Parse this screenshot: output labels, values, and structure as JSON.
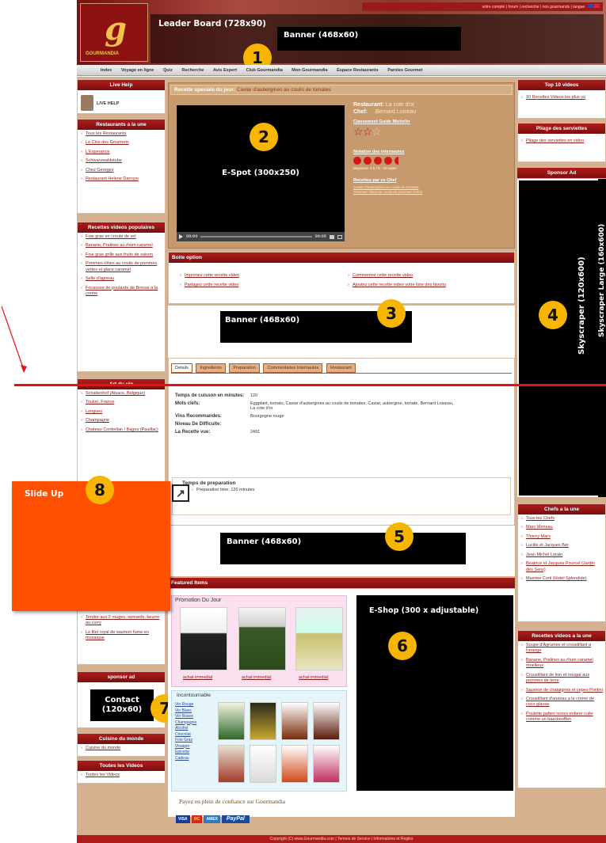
{
  "colors": {
    "accent": "#b01c1c",
    "sidebar_bg": "#d5b18f",
    "ad_black": "#000000",
    "slide_orange": "#ff4f00",
    "badge": "#f7b500",
    "tan": "#c69a6d"
  },
  "header": {
    "logo_text": "GOURMANDIA",
    "top_links": [
      "votre compte",
      "forum",
      "recherche",
      "nos gourmands",
      "langue"
    ],
    "leaderboard_label": "Leader Board (728x90)",
    "banner_label": "Banner (468x60)",
    "badge": "1"
  },
  "nav": [
    "Index",
    "Voyage en ligne",
    "Quiz",
    "Recherche",
    "Avis Expert",
    "Club Gourmandia",
    "Mon Gourmandia",
    "Espace Restaurants",
    "Paroles Gourmet"
  ],
  "left": {
    "live_help_title": "Live Help",
    "live_help_label": "LIVE HELP",
    "restaurants_title": "Restaurants a la une",
    "restaurants": [
      "Tous les Restaurants",
      "Le Clos des Gourmets",
      "L'Esperance",
      "Schwarzwaldstube",
      "Chez Georges",
      "Restaurant Helene Darroze"
    ],
    "videos_title": "Recettes videos populaires",
    "videos": [
      "Foie gras en croute de sel",
      "Banane, Pralines au rhum caramel",
      "Foie gras grille aux fruits de saison",
      "Pommes rôties au coulis de pommes vertes et glace caramel",
      "Selle d'agneau",
      "Fricassee de poularde de Bresse a la creme"
    ],
    "art_title": "Art du vin",
    "art": [
      "Schaltenhof (Alsace, Belgique)",
      "Toulon, France",
      "Longues",
      "Champagne",
      "Chateau Cordeillan / Bages (Pauillac)"
    ],
    "lower_links": [
      "Tendre aux 2 rouges, epinards, beurre au curry",
      "Le filet royal de saumon fume en mosaique"
    ],
    "sponsor_title": "sponsor ad",
    "contact_label": "Contact (120x60)",
    "cuisine_title": "Cuisine du monde",
    "cuisine_link": "Cuisine du monde",
    "toutes_title": "Toutes les Videos",
    "toutes_link": "Toutes les Videos",
    "badge": "7"
  },
  "slide_up": {
    "label": "Slide Up",
    "badge": "8"
  },
  "recipe": {
    "title_prefix": "Recette speciale du jour:",
    "title": "Caviar d'aubergines au coulis de tomates",
    "restaurant_label": "Restaurant:",
    "restaurant_value": "La cote d'or",
    "chef_label": "Chef:",
    "chef_value": "Bernard Loiseau",
    "guide_label": "Classement Guide Michelin",
    "stars_label": "Notation des internautes",
    "votes": "Moyenne: 4.5 / 5 - 10 votes",
    "more_label": "Recettes par ce Chef",
    "more_links": [
      "Caviar d'aubergines au coulis de tomates",
      "Pommes rôties au coulis de pommes vertes"
    ],
    "video_label": "E-Spot (300x250)",
    "video_time_left": "00:00",
    "video_time_right": "00:05",
    "badge": "2"
  },
  "options": {
    "title": "Boite option",
    "items": [
      "Imprimez cette recette video",
      "Partagez cette recette video",
      "Commentez cette recette video",
      "Ajoutez cette recette video votre liste des favoris"
    ]
  },
  "banner3": {
    "label": "Banner (468x60)",
    "badge": "3"
  },
  "tabs": [
    "Details",
    "Ingredients",
    "Preparation",
    "Commentaires Internautes",
    "Restaurant"
  ],
  "details": [
    {
      "label": "Temps de cuisson en minutes:",
      "value": "120"
    },
    {
      "label": "Mots clefs:",
      "value": "Eggplant, tomato, Caviar d'aubergines au coulis de tomates, Caviar, aubergine, tomate, Bernard Loiseau, La cote d'or"
    },
    {
      "label": "Vins Recommandes:",
      "value": "Bourgogne rouge"
    },
    {
      "label": "Niveau De Difficulte:",
      "value": ""
    },
    {
      "label": "La Recette vue:",
      "value": "2491"
    }
  ],
  "prep": {
    "title": "Temps de preparation",
    "text": "Preparation time: 120 minutes"
  },
  "banner5": {
    "label": "Banner (468x60)",
    "badge": "5"
  },
  "featured": {
    "title": "Featured Items",
    "promo_title": "Promotion Du Jour",
    "buy_labels": [
      "achat immediat",
      "achat immediat",
      "achat immediat"
    ],
    "incont_title": "Incontournable",
    "incont_links": [
      "Vin Rouge",
      "Vin Blanc",
      "Vin Rosee",
      "Champagne",
      "Alcohol",
      "Chocolat",
      "Foie Gras",
      "Vinaigre",
      "Epicerie",
      "Cadeau"
    ],
    "pay_text": "Payez en plein de confiance sur Gourmandia",
    "pay_cards": [
      "VISA",
      "MC",
      "AMEX",
      "PayPal"
    ],
    "eshop_label": "E-Shop (300 x adjustable)",
    "badge": "6"
  },
  "right": {
    "top10_title": "Top 10 videos",
    "top10_link": "10 Recettes Videos les plus vu",
    "pliage_title": "Pliage des serviettes",
    "pliage_link": "Pliage des serviettes en video",
    "sponsor_title": "Sponsor Ad",
    "sky1": "Skyscraper (120x600)",
    "sky2": "Skyscraper Large (160x600)",
    "badge": "4",
    "chefs_title": "Chefs a la une",
    "chefs": [
      "Tous les Chefs",
      "Marc Meneau",
      "Thierry Marx",
      "Lucille et Jacques Ber",
      "Jean Michel Lorain",
      "Beatrice et Jacques Pourcel (Jardin des Sens)",
      "Maxime Corti (Hotel Splendide)"
    ],
    "videos_title": "Recettes videos a la une",
    "videos": [
      "Soupe d'Agrumes et croustillant a l'orange",
      "Banane, Pralines au rhum caramel moelleux",
      "Croustillant de lion et nougat aux pommes de terre",
      "Saumon de chataignes et cepes Pontini",
      "Croustillant d'ananas a la creme de coco glacee",
      "Poulette pattes noires entiere cuite comme un baeckeoffen"
    ]
  },
  "footer": "Copyright (C) www.Gourmandia.com | Termes de Service | Informations et Regles"
}
